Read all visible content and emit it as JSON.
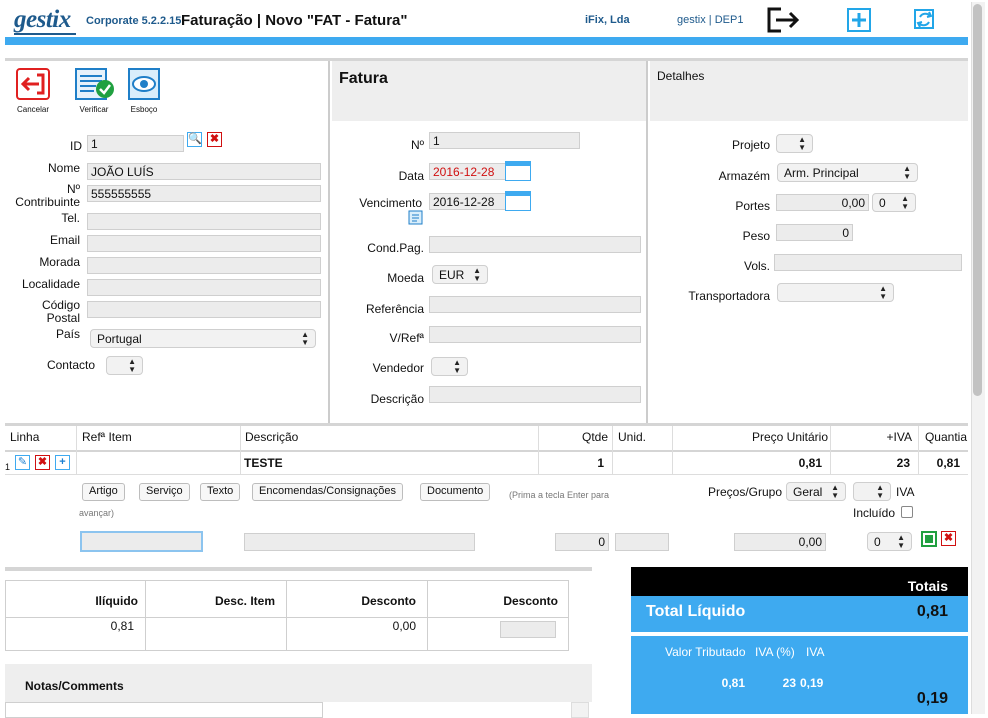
{
  "header": {
    "logo": "gestix",
    "version": "Corporate 5.2.2.15",
    "title": "Faturação | Novo \"FAT - Fatura\"",
    "company": "iFix, Lda",
    "user": "gestix | DEP1"
  },
  "toolbar": {
    "cancel": "Cancelar",
    "verify": "Verificar",
    "draft": "Esboço"
  },
  "section_titles": {
    "invoice": "Fatura",
    "details": "Detalhes"
  },
  "client": {
    "id_label": "ID",
    "id_value": "1",
    "name_label": "Nome",
    "name_value": "JOÃO LUÍS",
    "nif_label": "Nº Contribuinte",
    "nif_value": "555555555",
    "tel_label": "Tel.",
    "email_label": "Email",
    "address_label": "Morada",
    "city_label": "Localidade",
    "postal_label": "Código Postal",
    "country_label": "País",
    "country_value": "Portugal",
    "contact_label": "Contacto"
  },
  "invoice": {
    "number_label": "Nº",
    "number_value": "1",
    "date_label": "Data",
    "date_value": "2016-12-28",
    "due_label": "Vencimento",
    "due_value": "2016-12-28",
    "payment_label": "Cond.Pag.",
    "currency_label": "Moeda",
    "currency_value": "EUR",
    "reference_label": "Referência",
    "vref_label": "V/Refª",
    "seller_label": "Vendedor",
    "description_label": "Descrição"
  },
  "details": {
    "project_label": "Projeto",
    "warehouse_label": "Armazém",
    "warehouse_value": "Arm. Principal",
    "shipping_label": "Portes",
    "shipping_value": "0,00",
    "shipping_vat": "0",
    "weight_label": "Peso",
    "weight_value": "0",
    "volumes_label": "Vols.",
    "carrier_label": "Transportadora"
  },
  "lines": {
    "headers": {
      "line": "Linha",
      "ref": "Refª Item",
      "desc": "Descrição",
      "qty": "Qtde",
      "unit": "Unid.",
      "price": "Preço Unitário",
      "vat": "+IVA",
      "amount": "Quantia"
    },
    "row": {
      "num": "1",
      "desc": "TESTE",
      "qty": "1",
      "price": "0,81",
      "vat": "23",
      "amount": "0,81"
    },
    "add_buttons": [
      "Artigo",
      "Serviço",
      "Texto",
      "Encomendas/Consignações",
      "Documento"
    ],
    "hint": "(Prima a tecla Enter para avançar)",
    "price_group_label": "Preços/Grupo",
    "price_group_value": "Geral",
    "vat_label": "IVA",
    "included_label": "Incluído",
    "new_qty": "0",
    "new_price": "0,00",
    "new_vat": "0"
  },
  "summary": {
    "headers": [
      "Ilíquido",
      "Desc. Item",
      "Desconto",
      "Desconto"
    ],
    "values": [
      "0,81",
      "",
      "0,00",
      ""
    ]
  },
  "notes": {
    "title": "Notas/Comments"
  },
  "totals": {
    "title": "Totais",
    "net_label": "Total Líquido",
    "net_value": "0,81",
    "taxable_label": "Valor Tributado",
    "vat_pct_label": "IVA (%)",
    "vat_label": "IVA",
    "taxable_value": "0,81",
    "vat_pct_value": "23",
    "vat_value": "0,19",
    "vat_total": "0,19"
  }
}
